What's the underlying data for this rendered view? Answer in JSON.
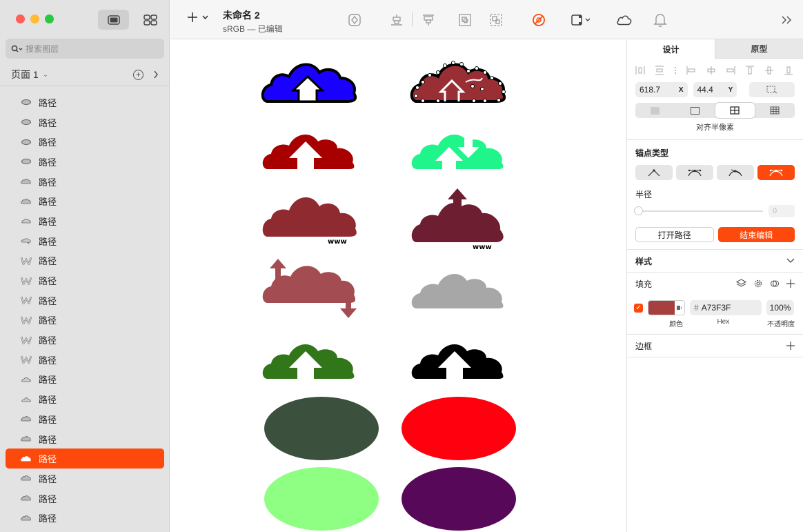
{
  "window": {
    "traffic_lights": [
      "#ff5f57",
      "#febc2e",
      "#28c840"
    ]
  },
  "sidebar": {
    "search_placeholder": "搜索图层",
    "page_name": "页面 1",
    "layers": [
      {
        "label": "路径",
        "icon": "ellipse-icon",
        "selected": false
      },
      {
        "label": "路径",
        "icon": "ellipse-icon",
        "selected": false
      },
      {
        "label": "路径",
        "icon": "ellipse-icon",
        "selected": false
      },
      {
        "label": "路径",
        "icon": "ellipse-icon",
        "selected": false
      },
      {
        "label": "路径",
        "icon": "cloud-shape-icon",
        "selected": false
      },
      {
        "label": "路径",
        "icon": "cloud-shape-icon",
        "selected": false
      },
      {
        "label": "路径",
        "icon": "cloud-flat-icon",
        "selected": false
      },
      {
        "label": "路径",
        "icon": "cloud-arrow-icon",
        "selected": false
      },
      {
        "label": "路径",
        "icon": "w-shape-icon",
        "selected": false
      },
      {
        "label": "路径",
        "icon": "w-shape-icon",
        "selected": false
      },
      {
        "label": "路径",
        "icon": "w-shape-icon",
        "selected": false
      },
      {
        "label": "路径",
        "icon": "w-shape-icon",
        "selected": false
      },
      {
        "label": "路径",
        "icon": "w-shape-icon",
        "selected": false
      },
      {
        "label": "路径",
        "icon": "w-shape-icon",
        "selected": false
      },
      {
        "label": "路径",
        "icon": "cloud-flat-icon",
        "selected": false
      },
      {
        "label": "路径",
        "icon": "cloud-up-icon",
        "selected": false
      },
      {
        "label": "路径",
        "icon": "cloud-shape-icon",
        "selected": false
      },
      {
        "label": "路径",
        "icon": "cloud-shape-icon",
        "selected": false
      },
      {
        "label": "路径",
        "icon": "cloud-shape-icon",
        "selected": true
      },
      {
        "label": "路径",
        "icon": "cloud-shape-icon",
        "selected": false
      },
      {
        "label": "路径",
        "icon": "cloud-shape-icon",
        "selected": false
      },
      {
        "label": "路径",
        "icon": "cloud-shape-icon",
        "selected": false
      }
    ]
  },
  "toolbar": {
    "doc_title": "未命名 2",
    "doc_subtitle": "sRGB — 已编辑",
    "icons": [
      "add-icon",
      "symbol-icon",
      "align-bottom-icon",
      "align-top-icon",
      "group-icon",
      "ungroup-icon",
      "no-fill-icon",
      "frame-icon",
      "cloud-icon",
      "bell-icon",
      "expand-icon"
    ]
  },
  "canvas": {
    "shapes": [
      {
        "kind": "cloud-upload",
        "fill": "#1a00ff",
        "stroke": "#000000"
      },
      {
        "kind": "cloud-dotted",
        "fill": "#9a2e35",
        "stroke": "#000000"
      },
      {
        "kind": "cloud-upload",
        "fill": "#a80000"
      },
      {
        "kind": "cloud-sync",
        "fill": "#1ff58a"
      },
      {
        "kind": "cloud-www",
        "fill": "#8f2a31",
        "text": "www"
      },
      {
        "kind": "cloud-www-up",
        "fill": "#6e1e31",
        "text": "www"
      },
      {
        "kind": "cloud-arrows",
        "fill": "#a34d53"
      },
      {
        "kind": "cloud-plain",
        "fill": "#a6a7a6"
      },
      {
        "kind": "cloud-upload",
        "fill": "#317619"
      },
      {
        "kind": "cloud-upload",
        "fill": "#000000"
      },
      {
        "kind": "ellipse",
        "fill": "#3b513d"
      },
      {
        "kind": "ellipse",
        "fill": "#ff000f"
      },
      {
        "kind": "ellipse",
        "fill": "#8eff82"
      },
      {
        "kind": "ellipse",
        "fill": "#580858"
      }
    ]
  },
  "inspector": {
    "tabs": [
      "设计",
      "原型"
    ],
    "active_tab": "设计",
    "x_value": "618.7",
    "x_label": "X",
    "y_value": "44.4",
    "y_label": "Y",
    "pixel_align_label": "对齐半像素",
    "anchor_type_title": "锚点类型",
    "radius_label": "半径",
    "radius_value": "0",
    "open_path_button": "打开路径",
    "end_edit_button": "结束编辑",
    "style_title": "样式",
    "fill_title": "填充",
    "fill_color": "#A73F3F",
    "fill_hex": "A73F3F",
    "fill_hex_prefix": "#",
    "fill_opacity": "100%",
    "label_color": "颜色",
    "label_hex": "Hex",
    "label_opacity": "不透明度",
    "border_title": "边框",
    "accent": "#fd4a0c"
  }
}
